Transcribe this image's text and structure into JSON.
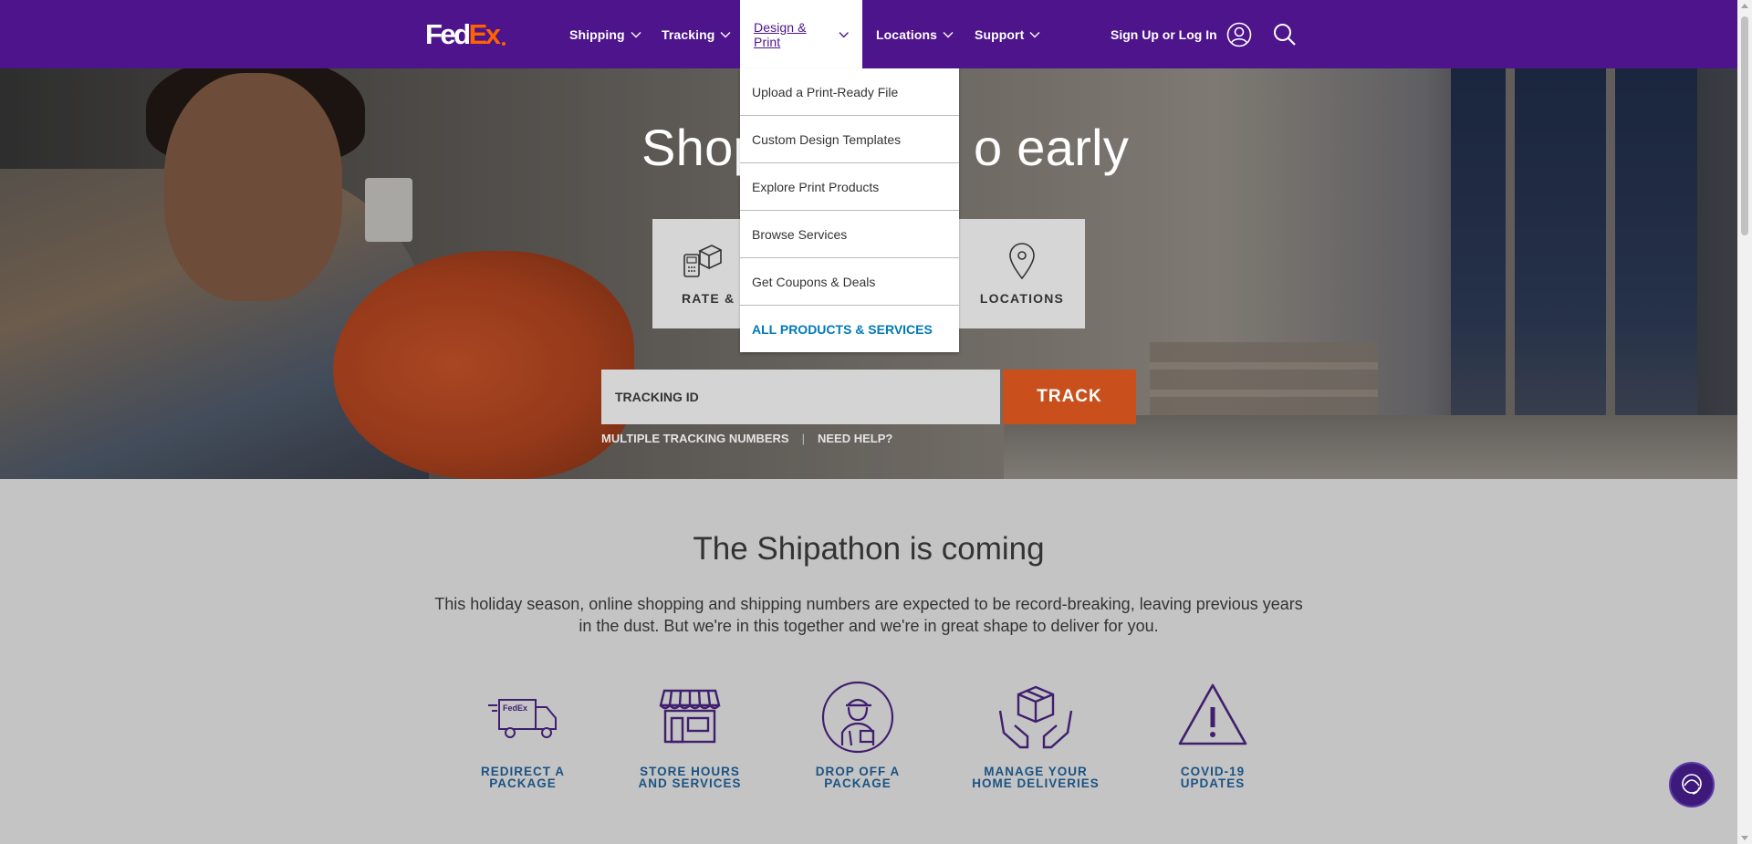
{
  "colors": {
    "header_purple": "#4d148c",
    "fedex_orange": "#ff6200",
    "track_button": "#c9501c",
    "link_blue": "#007ab7",
    "feature_label_blue": "#1b5384"
  },
  "header": {
    "logo": {
      "fed": "Fed",
      "ex": "Ex"
    },
    "nav": [
      {
        "label": "Shipping"
      },
      {
        "label": "Tracking"
      },
      {
        "label": "Design & Print"
      },
      {
        "label": "Locations"
      },
      {
        "label": "Support"
      }
    ],
    "signin_label": "Sign Up or Log In",
    "icons": {
      "account": "user-circle-icon",
      "search": "search-icon",
      "chevron": "chevron-down-icon"
    }
  },
  "dropdown": {
    "items": [
      {
        "label": "Upload a Print-Ready File"
      },
      {
        "label": "Custom Design Templates"
      },
      {
        "label": "Explore Print Products"
      },
      {
        "label": "Browse Services"
      },
      {
        "label": "Get Coupons & Deals"
      },
      {
        "label": "ALL PRODUCTS & SERVICES"
      }
    ]
  },
  "hero": {
    "title_part1": "Shop",
    "title_part2": "o early",
    "tiles": [
      {
        "label": "RATE & S",
        "icon": "rate-ship-icon"
      },
      {
        "label": "LOCATIONS",
        "icon": "location-pin-icon"
      }
    ],
    "tracking": {
      "placeholder": "TRACKING ID",
      "button_label": "TRACK",
      "multiple_label": "MULTIPLE TRACKING NUMBERS",
      "separator": "|",
      "help_label": "NEED HELP?"
    }
  },
  "shipathon": {
    "title": "The Shipathon is coming",
    "body": "This holiday season, online shopping and shipping numbers are expected to be record-breaking, leaving previous years in the dust. But we're in this together and we're in great shape to deliver for you.",
    "features": [
      {
        "line1": "REDIRECT A",
        "line2": "PACKAGE",
        "icon": "delivery-truck-icon"
      },
      {
        "line1": "STORE HOURS",
        "line2": "AND SERVICES",
        "icon": "storefront-icon"
      },
      {
        "line1": "DROP OFF A",
        "line2": "PACKAGE",
        "icon": "courier-person-icon"
      },
      {
        "line1": "MANAGE YOUR",
        "line2": "HOME DELIVERIES",
        "icon": "hands-holding-box-icon"
      },
      {
        "line1": "COVID-19",
        "line2": "UPDATES",
        "icon": "warning-triangle-icon"
      }
    ]
  },
  "chat": {
    "icon": "chat-support-icon"
  }
}
